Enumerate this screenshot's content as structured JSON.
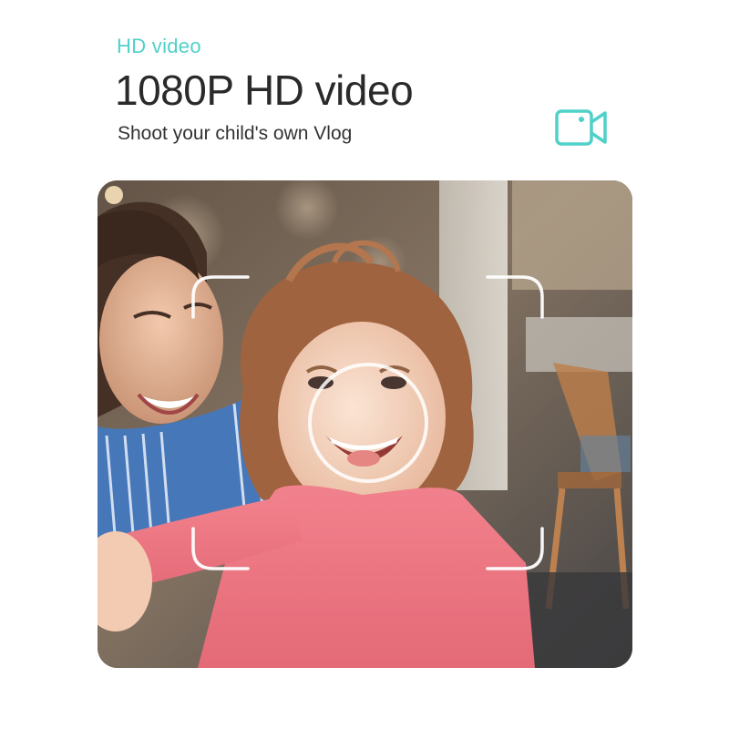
{
  "header": {
    "eyebrow": "HD video",
    "title": "1080P HD video",
    "subtitle": "Shoot your child's own Vlog"
  },
  "icons": {
    "video": "video-camera-icon",
    "focus_frame": "focus-frame-icon",
    "focus_circle": "focus-circle-icon"
  },
  "colors": {
    "accent": "#4fd1c9",
    "title_text": "#2a2a2a",
    "subtitle_text": "#333333"
  },
  "photo": {
    "subject": "photo of a child taking a selfie with a smiling woman"
  }
}
